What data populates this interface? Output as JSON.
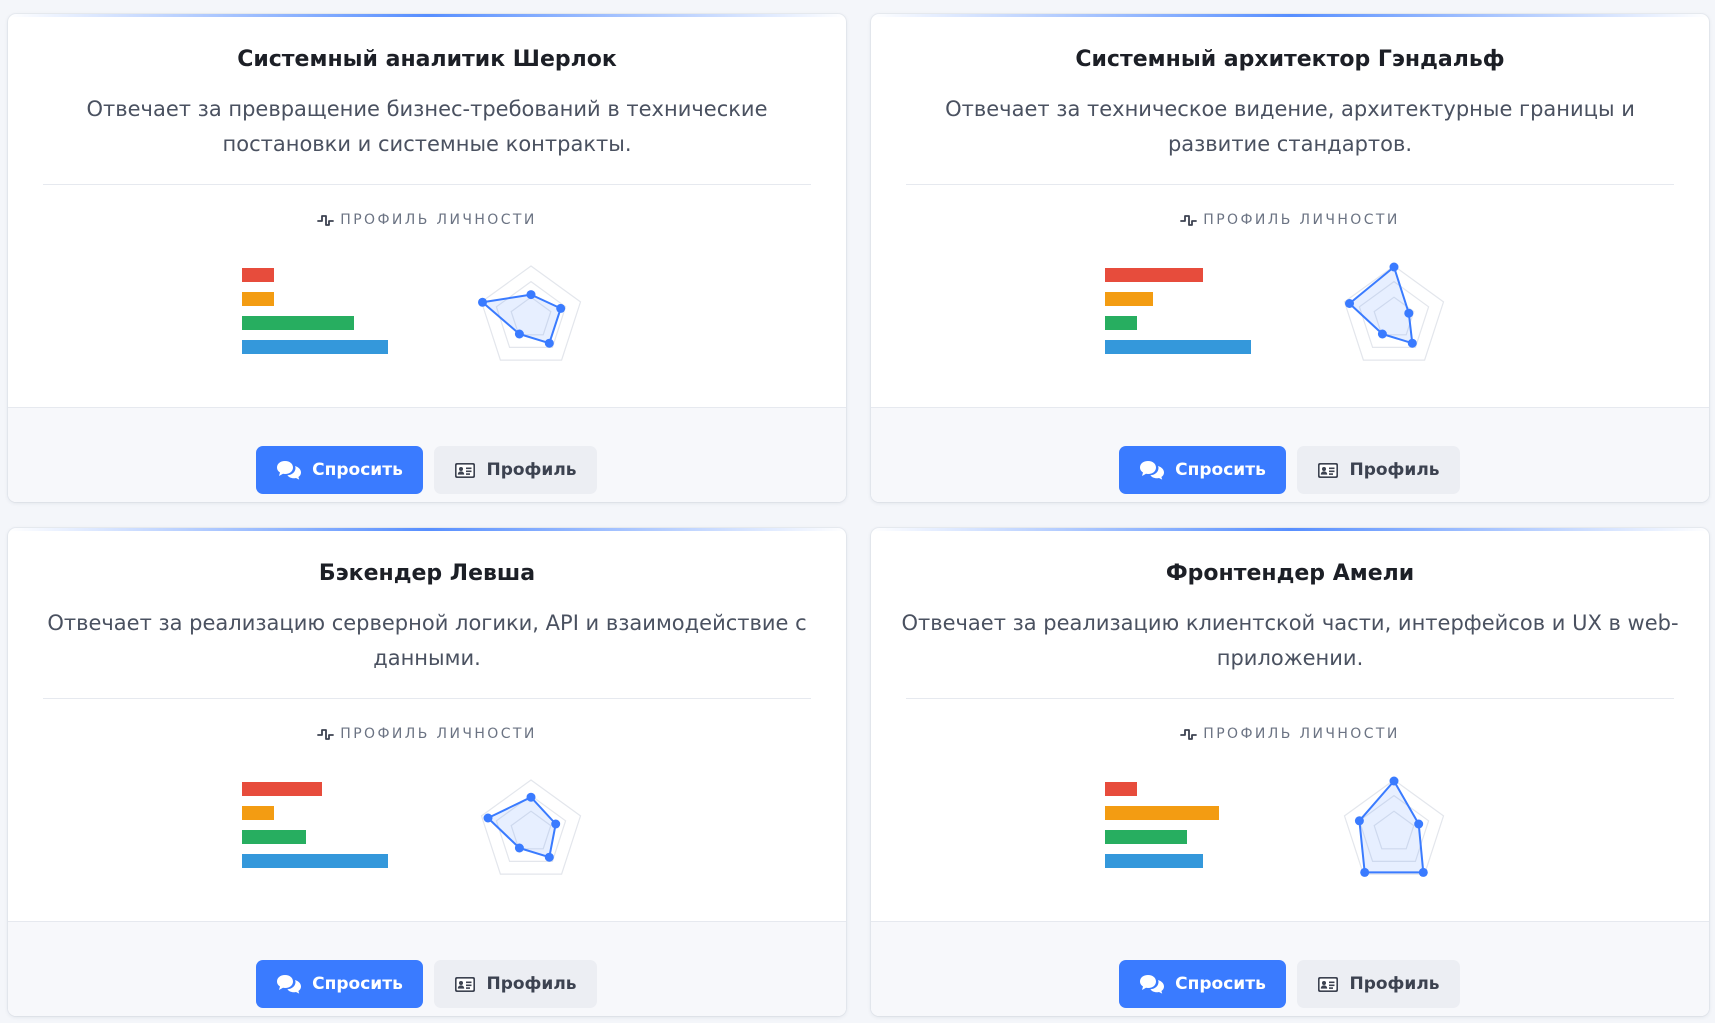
{
  "common": {
    "profile_label": "ПРОФИЛЬ ЛИЧНОСТИ",
    "ask_label": "Спросить",
    "profile_button_label": "Профиль",
    "icons": {
      "ask": "chat-bubbles-icon",
      "profile": "id-card-icon",
      "section": "pulse-icon"
    },
    "colors": {
      "accent": "#3a7bff",
      "bar_colors": [
        "#e74c3c",
        "#f39c12",
        "#27ae60",
        "#3498db"
      ],
      "radar_stroke": "#3a7bff",
      "radar_grid": "#e3e6ec"
    }
  },
  "cards": [
    {
      "title": "Системный аналитик Шерлок",
      "description": "Отвечает за превращение бизнес-требований в технические постановки и системные контракты.",
      "bar_levels": [
        0.22,
        0.22,
        0.77,
        1.0
      ],
      "radar_levels": [
        0.45,
        0.6,
        0.6,
        0.38,
        0.98
      ]
    },
    {
      "title": "Системный архитектор Гэндальф",
      "description": "Отвечает за техническое видение, архитектурные границы и развитие стандартов.",
      "bar_levels": [
        0.67,
        0.33,
        0.22,
        1.0
      ],
      "radar_levels": [
        0.98,
        0.3,
        0.6,
        0.38,
        0.9
      ]
    },
    {
      "title": "Бэкендер Левша",
      "description": "Отвечает за реализацию серверной логики, API и взаимодействие с данными.",
      "bar_levels": [
        0.55,
        0.22,
        0.44,
        1.0
      ],
      "radar_levels": [
        0.67,
        0.5,
        0.6,
        0.38,
        0.87
      ]
    },
    {
      "title": "Фронтендер Амели",
      "description": "Отвечает за реализацию клиентской части, интерфейсов и UX в web-приложении.",
      "bar_levels": [
        0.22,
        0.78,
        0.56,
        0.67
      ],
      "radar_levels": [
        0.98,
        0.5,
        0.96,
        0.96,
        0.7
      ]
    }
  ]
}
